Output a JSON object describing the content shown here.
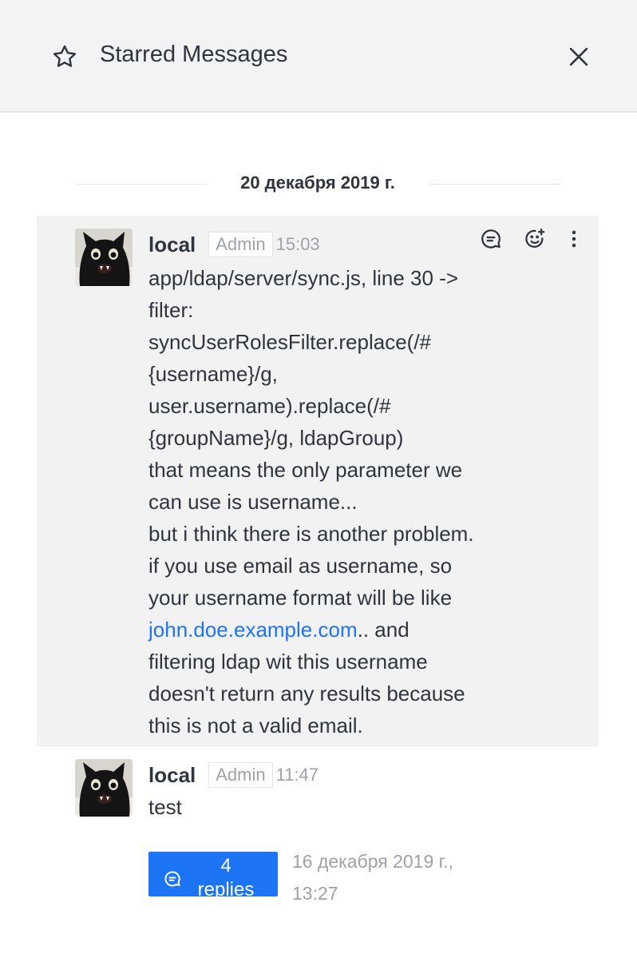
{
  "header": {
    "title": "Starred Messages",
    "icon": "star-icon",
    "close_icon": "close-icon"
  },
  "date_divider": "20 декабря 2019 г.",
  "messages": [
    {
      "username": "local",
      "role": "Admin",
      "time": "15:03",
      "lines": [
        "app/ldap/server/sync.js, line 30 ->",
        "filter:",
        "syncUserRolesFilter.replace(/#",
        "{username}/g,",
        "user.username).replace(/#",
        "{groupName}/g, ldapGroup)",
        "that means the only parameter we",
        "can use is username...",
        "but i think there is another problem.",
        "if you use email as username, so",
        "your username format will be like"
      ],
      "link_text": "john.doe.example.com",
      "link_suffix": ".. and",
      "lines_after": [
        "filtering ldap wit this username",
        "doesn't return any results because",
        "this is not a valid email."
      ],
      "actions": [
        "reply-in-thread-icon",
        "add-reaction-icon",
        "more-options-icon"
      ]
    },
    {
      "username": "local",
      "role": "Admin",
      "time": "11:47",
      "text": "test",
      "thread": {
        "count": "4",
        "label": "replies",
        "date": "16 декабря 2019 г.,",
        "time": "13:27"
      }
    }
  ],
  "colors": {
    "header_bg": "#f2f3f5",
    "highlight_bg": "#f2f2f2",
    "link": "#1d74f5",
    "thread_button": "#1d74f5",
    "muted_text": "#9ea2a8"
  }
}
